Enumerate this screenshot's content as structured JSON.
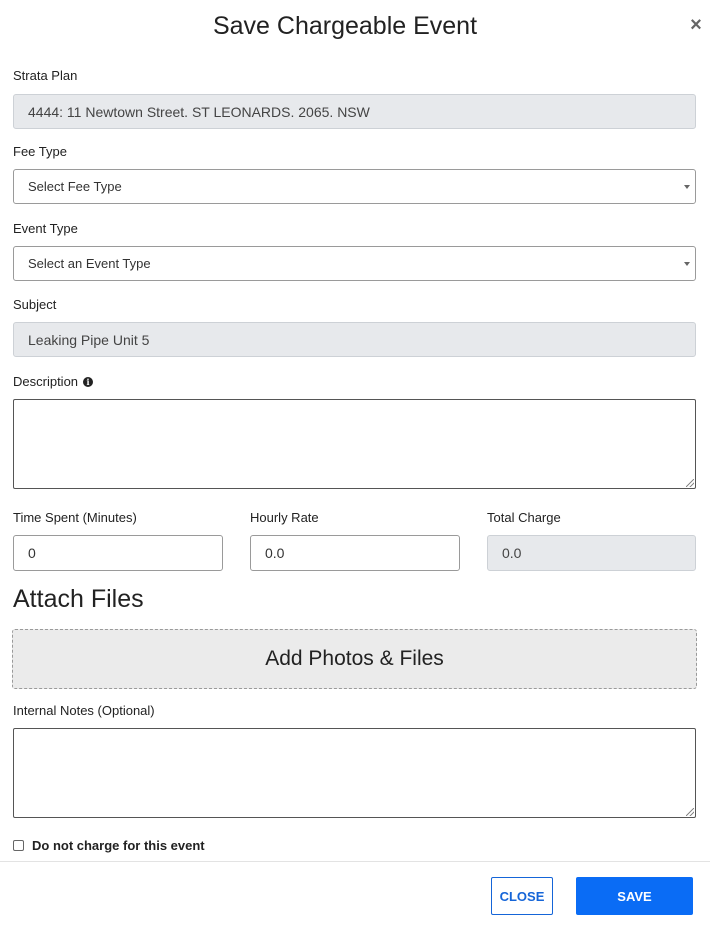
{
  "dialog": {
    "title": "Save Chargeable Event",
    "close_symbol": "×"
  },
  "form": {
    "strata_plan": {
      "label": "Strata Plan",
      "value": "4444: 11 Newtown Street. ST LEONARDS. 2065. NSW"
    },
    "fee_type": {
      "label": "Fee Type",
      "selected": "Select Fee Type"
    },
    "event_type": {
      "label": "Event Type",
      "selected": "Select an Event Type"
    },
    "subject": {
      "label": "Subject",
      "value": "Leaking Pipe Unit 5"
    },
    "description": {
      "label": "Description",
      "info_icon": "info-icon",
      "value": ""
    },
    "time_spent": {
      "label": "Time Spent (Minutes)",
      "value": "0"
    },
    "hourly_rate": {
      "label": "Hourly Rate",
      "value": "0.0"
    },
    "total_charge": {
      "label": "Total Charge",
      "value": "0.0"
    },
    "attach": {
      "heading": "Attach Files",
      "dropzone_label": "Add Photos & Files"
    },
    "internal_notes": {
      "label": "Internal Notes (Optional)",
      "value": ""
    },
    "no_charge": {
      "label": "Do not charge for this event",
      "checked": false
    }
  },
  "footer": {
    "close_label": "CLOSE",
    "save_label": "SAVE"
  },
  "colors": {
    "primary": "#0a6cf5",
    "disabled_field": "#e7e9ec",
    "dropzone": "#ebebeb"
  }
}
